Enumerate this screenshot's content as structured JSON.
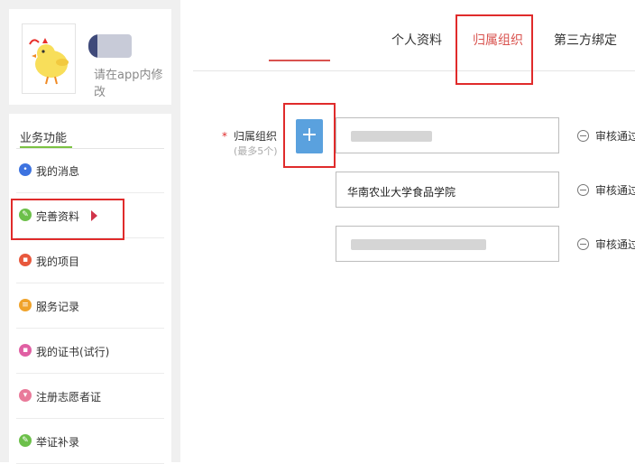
{
  "profile": {
    "name": "██",
    "edit_hint": "请在app内修改"
  },
  "menu": {
    "title": "业务功能",
    "items": [
      {
        "label": "我的消息",
        "icon": "message-icon",
        "color": "#3d73e0"
      },
      {
        "label": "完善资料",
        "icon": "edit-icon",
        "color": "#6cc04a"
      },
      {
        "label": "我的项目",
        "icon": "project-icon",
        "color": "#e8583d"
      },
      {
        "label": "服务记录",
        "icon": "record-icon",
        "color": "#f0a32a"
      },
      {
        "label": "我的证书(试行)",
        "icon": "certificate-icon",
        "color": "#e05fa3"
      },
      {
        "label": "注册志愿者证",
        "icon": "volunteer-card-icon",
        "color": "#e97a9a"
      },
      {
        "label": "举证补录",
        "icon": "supplement-icon",
        "color": "#6cc04a"
      }
    ]
  },
  "tabs": [
    {
      "label": "个人资料",
      "active": false
    },
    {
      "label": "归属组织",
      "active": true
    },
    {
      "label": "第三方绑定",
      "active": false
    }
  ],
  "form": {
    "required_mark": "*",
    "label": "归属组织",
    "sublabel": "(最多5个)",
    "add_label": "+",
    "orgs": [
      {
        "name": "",
        "status": "审核通过"
      },
      {
        "name": "华南农业大学食品学院",
        "status": "审核通过"
      },
      {
        "name": "",
        "status": "审核通过"
      }
    ]
  },
  "colors": {
    "accent_red": "#e02b2b",
    "active_tab": "#d9534f",
    "add_button": "#5aa1de",
    "menu_underline": "#7cc243"
  }
}
